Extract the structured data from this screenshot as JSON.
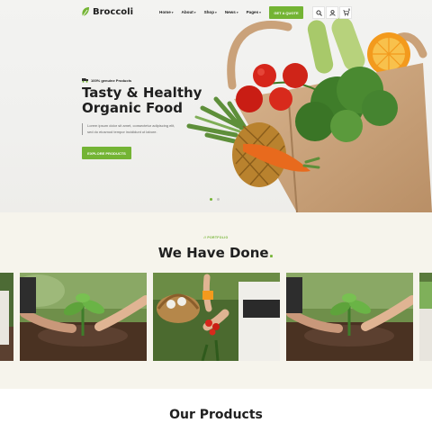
{
  "brand": {
    "name": "Broccoli",
    "accent": "#74b434"
  },
  "nav": {
    "items": [
      {
        "label": "Home",
        "dropdown": true
      },
      {
        "label": "About",
        "dropdown": true
      },
      {
        "label": "Shop",
        "dropdown": true
      },
      {
        "label": "News",
        "dropdown": true
      },
      {
        "label": "Pages",
        "dropdown": true
      },
      {
        "label": "Contact",
        "dropdown": false
      }
    ],
    "cta": "GET A QUOTE",
    "icons": [
      "search-icon",
      "user-icon",
      "cart-icon"
    ],
    "cart_count": "0"
  },
  "hero": {
    "badge": "100% genuine Products",
    "title_line1": "Tasty & Healthy",
    "title_line2": "Organic Food",
    "description": "Lorem ipsum dolor sit amet, consectetur adipiscing elit, sed do eiusmod tempor incididunt ut labore.",
    "button": "EXPLORE PRODUCTS",
    "slides": 2,
    "active_slide": 1
  },
  "portfolio": {
    "kicker": "// PORTFOLIO",
    "title": "We Have Done",
    "title_dot": "."
  },
  "products": {
    "title": "Our Products"
  }
}
